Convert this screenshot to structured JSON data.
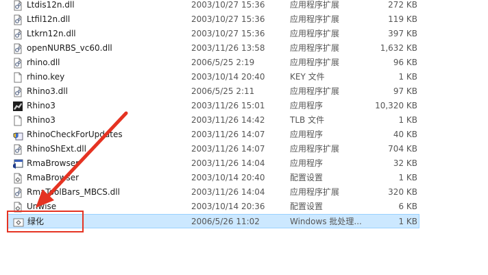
{
  "files": [
    {
      "name": "Ltdis12n.dll",
      "date": "2003/10/27 15:36",
      "type": "应用程序扩展",
      "size": "272 KB",
      "icon": "dll-icon"
    },
    {
      "name": "Ltfil12n.dll",
      "date": "2003/10/27 15:36",
      "type": "应用程序扩展",
      "size": "119 KB",
      "icon": "dll-icon"
    },
    {
      "name": "Ltkrn12n.dll",
      "date": "2003/10/27 15:36",
      "type": "应用程序扩展",
      "size": "397 KB",
      "icon": "dll-icon"
    },
    {
      "name": "openNURBS_vc60.dll",
      "date": "2003/11/26 13:58",
      "type": "应用程序扩展",
      "size": "1,632 KB",
      "icon": "dll-icon"
    },
    {
      "name": "rhino.dll",
      "date": "2006/5/25 2:19",
      "type": "应用程序扩展",
      "size": "96 KB",
      "icon": "dll-icon"
    },
    {
      "name": "rhino.key",
      "date": "2003/10/14 20:40",
      "type": "KEY 文件",
      "size": "1 KB",
      "icon": "file-icon"
    },
    {
      "name": "Rhino3.dll",
      "date": "2006/5/25 2:11",
      "type": "应用程序扩展",
      "size": "97 KB",
      "icon": "dll-icon"
    },
    {
      "name": "Rhino3",
      "date": "2003/11/26 15:01",
      "type": "应用程序",
      "size": "10,320 KB",
      "icon": "rhino-app-icon"
    },
    {
      "name": "Rhino3",
      "date": "2003/11/26 14:42",
      "type": "TLB 文件",
      "size": "1 KB",
      "icon": "file-icon"
    },
    {
      "name": "RhinoCheckForUpdates",
      "date": "2003/11/26 14:07",
      "type": "应用程序",
      "size": "40 KB",
      "icon": "shield-app-icon"
    },
    {
      "name": "RhinoShExt.dll",
      "date": "2003/11/26 14:07",
      "type": "应用程序扩展",
      "size": "704 KB",
      "icon": "dll-icon"
    },
    {
      "name": "RmaBrowser",
      "date": "2003/11/26 14:04",
      "type": "应用程序",
      "size": "32 KB",
      "icon": "browser-app-icon"
    },
    {
      "name": "RmaBrowser",
      "date": "2003/10/14 20:40",
      "type": "配置设置",
      "size": "1 KB",
      "icon": "config-icon"
    },
    {
      "name": "RmaToolBars_MBCS.dll",
      "date": "2003/11/26 14:04",
      "type": "应用程序扩展",
      "size": "320 KB",
      "icon": "dll-icon"
    },
    {
      "name": "Unwise",
      "date": "2003/10/14 20:36",
      "type": "配置设置",
      "size": "6 KB",
      "icon": "config-icon"
    },
    {
      "name": "绿化",
      "date": "2006/5/26 11:02",
      "type": "Windows 批处理...",
      "size": "1 KB",
      "icon": "batch-file-icon",
      "selected": true
    }
  ],
  "colors": {
    "selection_bg": "#cce8ff",
    "selection_border": "#99d1ff",
    "annotation": "#e53322"
  }
}
